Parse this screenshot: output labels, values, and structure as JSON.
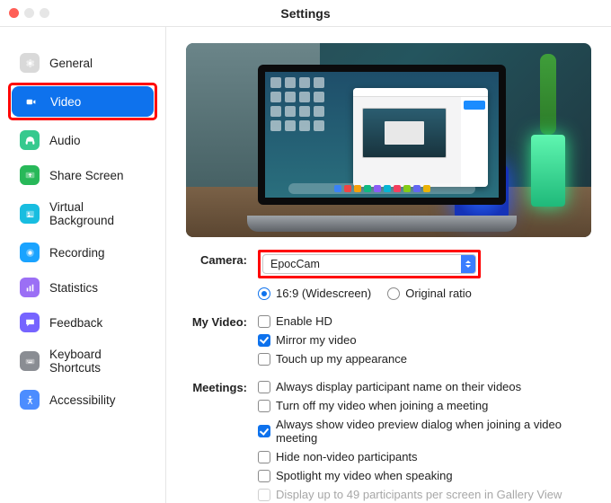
{
  "window": {
    "title": "Settings"
  },
  "sidebar": {
    "items": [
      {
        "label": "General"
      },
      {
        "label": "Video"
      },
      {
        "label": "Audio"
      },
      {
        "label": "Share Screen"
      },
      {
        "label": "Virtual Background"
      },
      {
        "label": "Recording"
      },
      {
        "label": "Statistics"
      },
      {
        "label": "Feedback"
      },
      {
        "label": "Keyboard Shortcuts"
      },
      {
        "label": "Accessibility"
      }
    ]
  },
  "camera": {
    "label": "Camera:",
    "selected": "EpocCam",
    "aspect_opts": {
      "widescreen": "16:9 (Widescreen)",
      "original": "Original ratio"
    }
  },
  "my_video": {
    "label": "My Video:",
    "enable_hd": "Enable HD",
    "mirror": "Mirror my video",
    "touchup": "Touch up my appearance"
  },
  "meetings": {
    "label": "Meetings:",
    "display_names": "Always display participant name on their videos",
    "turn_off_join": "Turn off my video when joining a meeting",
    "preview_dialog": "Always show video preview dialog when joining a video meeting",
    "hide_nonvideo": "Hide non-video participants",
    "spotlight": "Spotlight my video when speaking",
    "gallery49": "Display up to 49 participants per screen in Gallery View"
  }
}
